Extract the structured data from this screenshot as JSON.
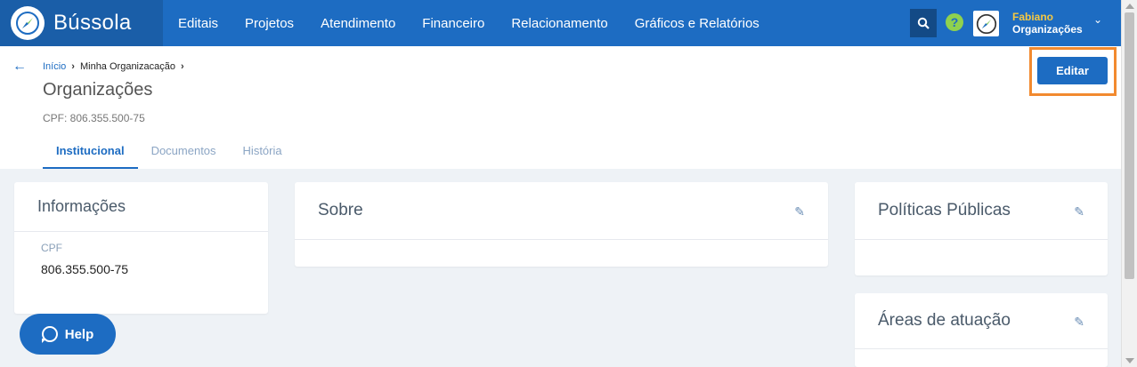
{
  "app": {
    "brand_name": "Bússola",
    "colors": {
      "primary": "#1d6cc2",
      "brand_bg": "#1a5ea8",
      "highlight": "#f28a2f",
      "user_name": "#f5c842"
    }
  },
  "nav": {
    "items": [
      "Editais",
      "Projetos",
      "Atendimento",
      "Financeiro",
      "Relacionamento",
      "Gráficos e Relatórios"
    ]
  },
  "user": {
    "name": "Fabiano",
    "org": "Organizações"
  },
  "breadcrumb": {
    "home": "Início",
    "current": "Minha Organizacação"
  },
  "page": {
    "title": "Organizações",
    "cpf_line": "CPF: 806.355.500-75",
    "edit_label": "Editar"
  },
  "tabs": [
    {
      "label": "Institucional",
      "active": true
    },
    {
      "label": "Documentos",
      "active": false
    },
    {
      "label": "História",
      "active": false
    }
  ],
  "cards": {
    "informacoes": {
      "title": "Informações",
      "field_label": "CPF",
      "field_value": "806.355.500-75"
    },
    "sobre": {
      "title": "Sobre"
    },
    "politicas": {
      "title": "Políticas Públicas"
    },
    "areas": {
      "title": "Áreas de atuação"
    }
  },
  "help": {
    "label": "Help"
  },
  "icons": {
    "edit": "pencil-icon",
    "search": "search-icon",
    "help": "question-icon",
    "back": "arrow-left-icon"
  }
}
